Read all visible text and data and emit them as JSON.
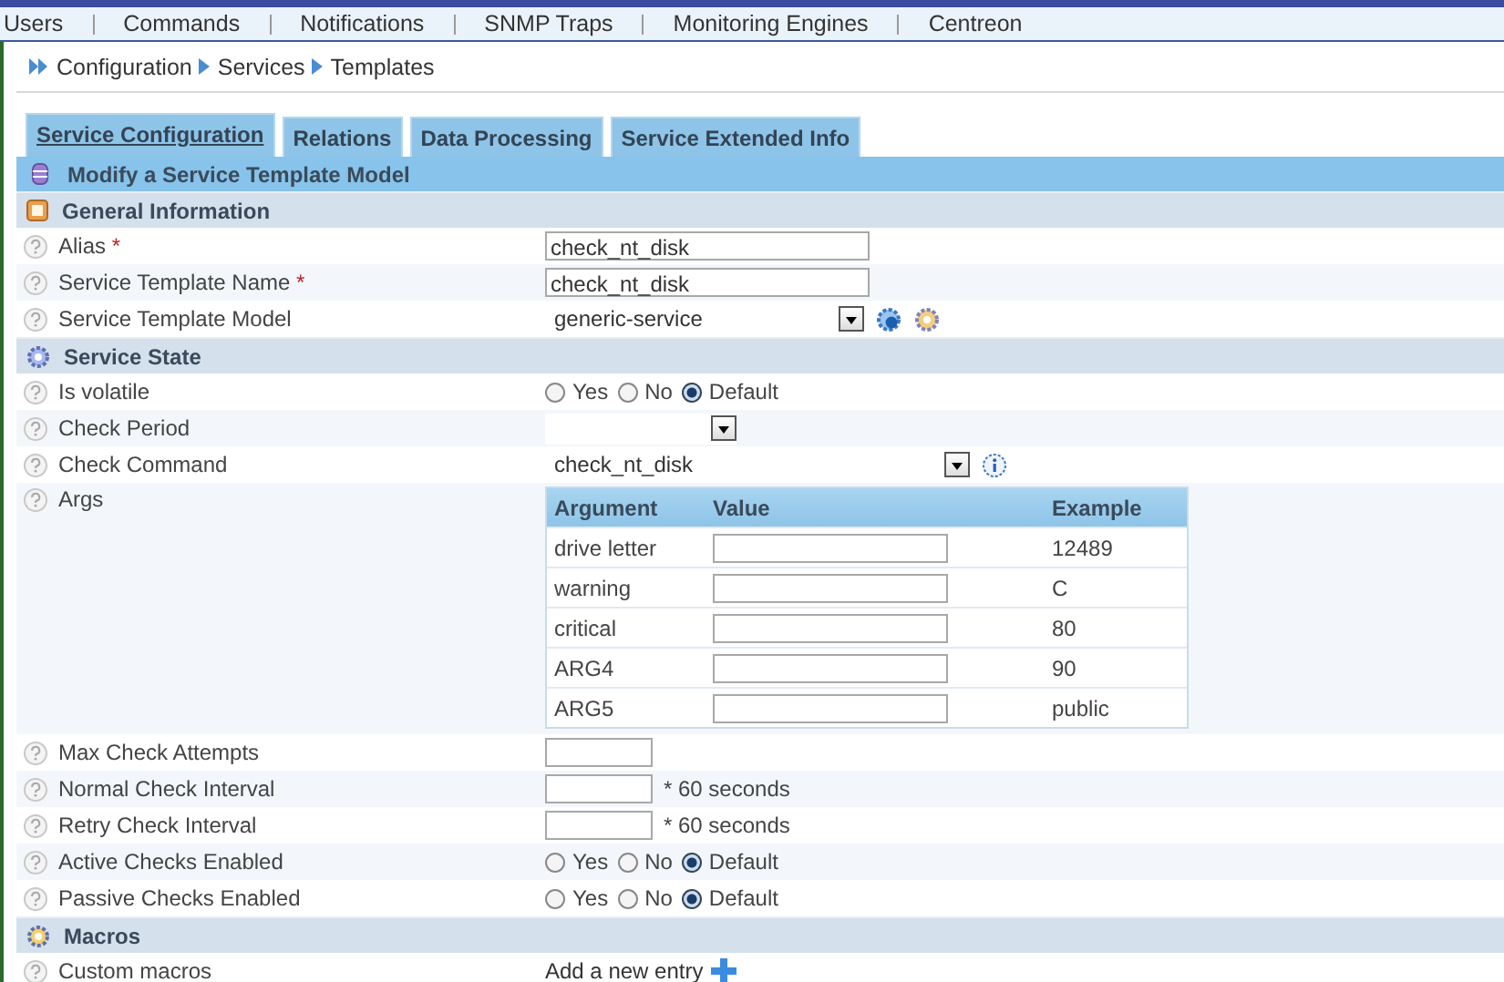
{
  "nav": [
    "Users",
    "Commands",
    "Notifications",
    "SNMP  Traps",
    "Monitoring  Engines",
    "Centreon"
  ],
  "breadcrumb": [
    "Configuration",
    "Services",
    "Templates"
  ],
  "tabs": [
    {
      "label": "Service Configuration",
      "selected": true
    },
    {
      "label": "Relations",
      "selected": false
    },
    {
      "label": "Data Processing",
      "selected": false
    },
    {
      "label": "Service Extended Info",
      "selected": false
    }
  ],
  "form_title": "Modify a Service Template Model",
  "sections": [
    {
      "title": "General Information",
      "kind": "info",
      "rows": [
        {
          "kind": "text",
          "label": "Alias",
          "mark": "*",
          "value": "check_nt_disk"
        },
        {
          "kind": "text",
          "label": "Service Template Name",
          "mark": "*",
          "value": "check_nt_disk"
        },
        {
          "kind": "template",
          "label": "Service Template Model",
          "value": "generic-service"
        }
      ]
    },
    {
      "title": "Service State",
      "kind": "state",
      "rows": [
        {
          "kind": "radio",
          "label": "Is volatile",
          "options": [
            {
              "label": "Yes",
              "selected": false
            },
            {
              "label": "No",
              "selected": false
            },
            {
              "label": "Default",
              "selected": true
            }
          ]
        },
        {
          "kind": "select",
          "label": "Check Period"
        },
        {
          "kind": "command",
          "label": "Check Command",
          "value": "check_nt_disk"
        },
        {
          "kind": "args",
          "label": "Args",
          "columns": [
            "Argument",
            "Value",
            "Example"
          ],
          "args": [
            {
              "argument": "drive letter",
              "example": "12489"
            },
            {
              "argument": "warning",
              "example": "C"
            },
            {
              "argument": "critical",
              "example": "80"
            },
            {
              "argument": "ARG4",
              "example": "90"
            },
            {
              "argument": "ARG5",
              "example": "public"
            }
          ]
        },
        {
          "kind": "number",
          "label": "Max Check Attempts"
        },
        {
          "kind": "interval",
          "label": "Normal Check Interval",
          "suffix": "* 60 seconds"
        },
        {
          "kind": "interval",
          "label": "Retry Check Interval",
          "suffix": "* 60 seconds"
        },
        {
          "kind": "radio",
          "label": "Active Checks Enabled",
          "options": [
            {
              "label": "Yes",
              "selected": false
            },
            {
              "label": "No",
              "selected": false
            },
            {
              "label": "Default",
              "selected": true
            }
          ]
        },
        {
          "kind": "radio",
          "label": "Passive Checks Enabled",
          "options": [
            {
              "label": "Yes",
              "selected": false
            },
            {
              "label": "No",
              "selected": false
            },
            {
              "label": "Default",
              "selected": true
            }
          ]
        }
      ]
    },
    {
      "title": "Macros",
      "kind": "macros",
      "rows": [
        {
          "kind": "macro",
          "label": "Custom macros",
          "link": "Add a new entry"
        }
      ]
    }
  ]
}
